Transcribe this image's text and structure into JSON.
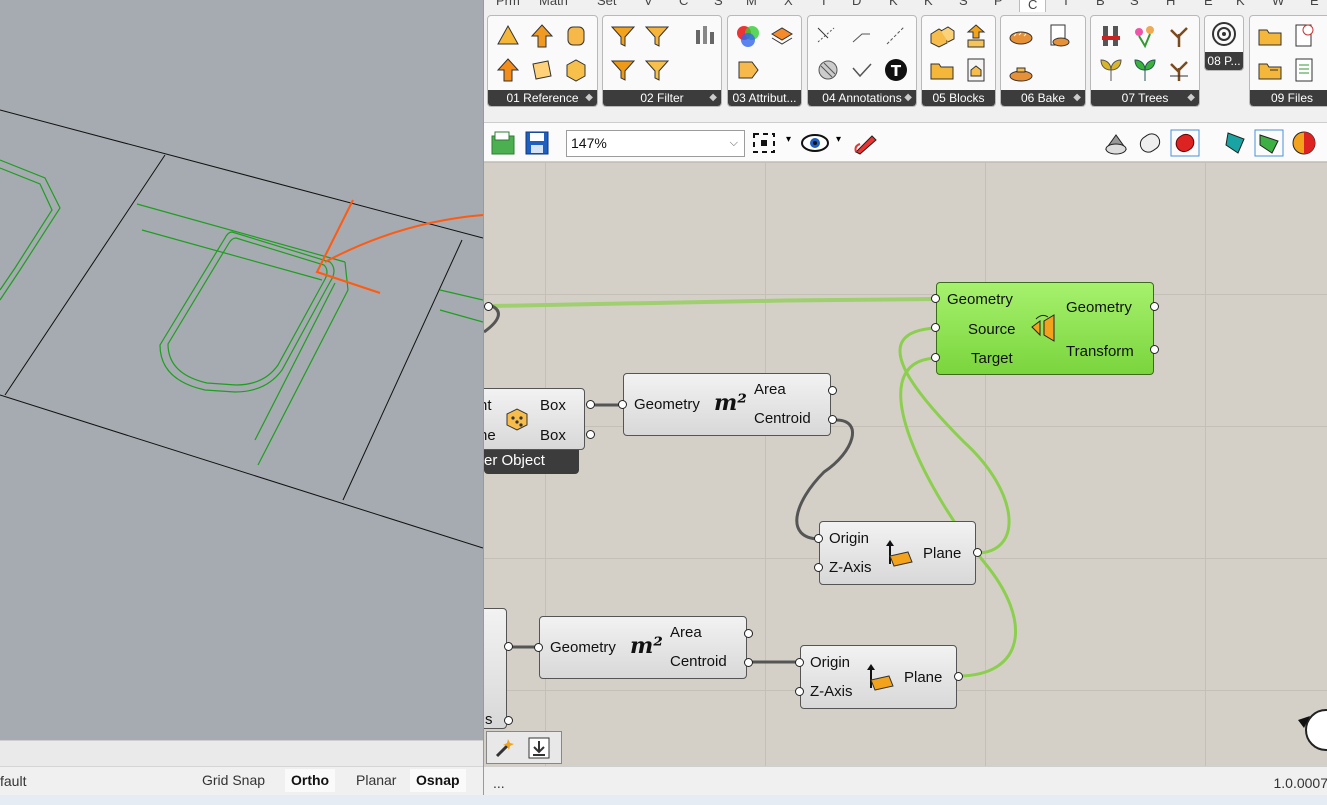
{
  "rhino": {
    "status_layer": "fault",
    "toggles": [
      {
        "label": "Grid Snap",
        "on": false
      },
      {
        "label": "Ortho",
        "on": true
      },
      {
        "label": "Planar",
        "on": false
      },
      {
        "label": "Osnap",
        "on": true
      }
    ]
  },
  "grasshopper": {
    "tabs": [
      "Prm",
      "Math",
      "Set",
      "V",
      "C",
      "S",
      "M",
      "X",
      "I",
      "D",
      "K",
      "K",
      "S",
      "P",
      "C",
      "T",
      "B",
      "S",
      "H",
      "E",
      "K",
      "W",
      "E"
    ],
    "active_tab_index": 14,
    "panels": [
      {
        "label": "01 Reference"
      },
      {
        "label": "02 Filter"
      },
      {
        "label": "03 Attribut..."
      },
      {
        "label": "04 Annotations"
      },
      {
        "label": "05 Blocks"
      },
      {
        "label": "06 Bake"
      },
      {
        "label": "07 Trees"
      },
      {
        "label": "08 P..."
      },
      {
        "label": "09 Files"
      }
    ],
    "zoom": "147%",
    "status_left": "...",
    "status_right": "1.0.0007",
    "components": {
      "orient": {
        "inputs": [
          "Geometry",
          "Source",
          "Target"
        ],
        "outputs": [
          "Geometry",
          "Transform"
        ],
        "icon": "orient-icon"
      },
      "box_object": {
        "inputs": [
          "nt",
          "ne"
        ],
        "outputs": [
          "Box",
          "Box"
        ],
        "footer": "er Object",
        "icon": "box-dice-icon"
      },
      "area1": {
        "inputs": [
          "Geometry"
        ],
        "outputs": [
          "Area",
          "Centroid"
        ],
        "symbol": "m²"
      },
      "plane1": {
        "inputs": [
          "Origin",
          "Z-Axis"
        ],
        "outputs": [
          "Plane"
        ],
        "icon": "plane-icon"
      },
      "area2": {
        "inputs": [
          "Geometry"
        ],
        "outputs": [
          "Area",
          "Centroid"
        ],
        "symbol": "m²"
      },
      "plane2": {
        "inputs": [
          "Origin",
          "Z-Axis"
        ],
        "outputs": [
          "Plane"
        ],
        "icon": "plane-icon"
      },
      "partial": {
        "outputs": [
          "s"
        ]
      }
    }
  },
  "colors": {
    "accent_green": "#7ad53d",
    "wire_green": "#8ccf4f",
    "sketch_orange": "#ff5a10",
    "rhino_curve_green": "#1f9e1f"
  }
}
